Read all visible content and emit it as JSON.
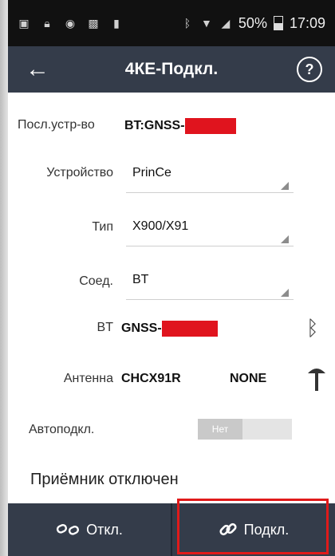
{
  "status_bar": {
    "left_icons": [
      "app-icon",
      "lock-icon",
      "eye-icon",
      "image-icon",
      "card-icon"
    ],
    "right_icons": [
      "bluetooth-icon",
      "wifi-icon",
      "signal-icon"
    ],
    "battery": "50%",
    "time": "17:09"
  },
  "appbar": {
    "title": "4КЕ-Подкл.",
    "help": "?"
  },
  "form": {
    "last_device_label": "Посл.устр-во",
    "last_device_value": "BT:GNSS-",
    "device_label": "Устройство",
    "device_value": "PrinCe",
    "type_label": "Тип",
    "type_value": "X900/X91",
    "conn_label": "Соед.",
    "conn_value": "BT",
    "bt_label": "BT",
    "bt_value": "GNSS-",
    "antenna_label": "Антенна",
    "antenna_value": "CHCX91R",
    "antenna_extra": "NONE",
    "autoconnect_label": "Автоподкл.",
    "autoconnect_value": "Нет"
  },
  "receiver_status": "Приёмник отключен",
  "buttons": {
    "disconnect": "Откл.",
    "connect": "Подкл."
  },
  "colors": {
    "accent": "#343c4a",
    "redaction": "#e0141e",
    "highlight": "#e01a1a"
  }
}
